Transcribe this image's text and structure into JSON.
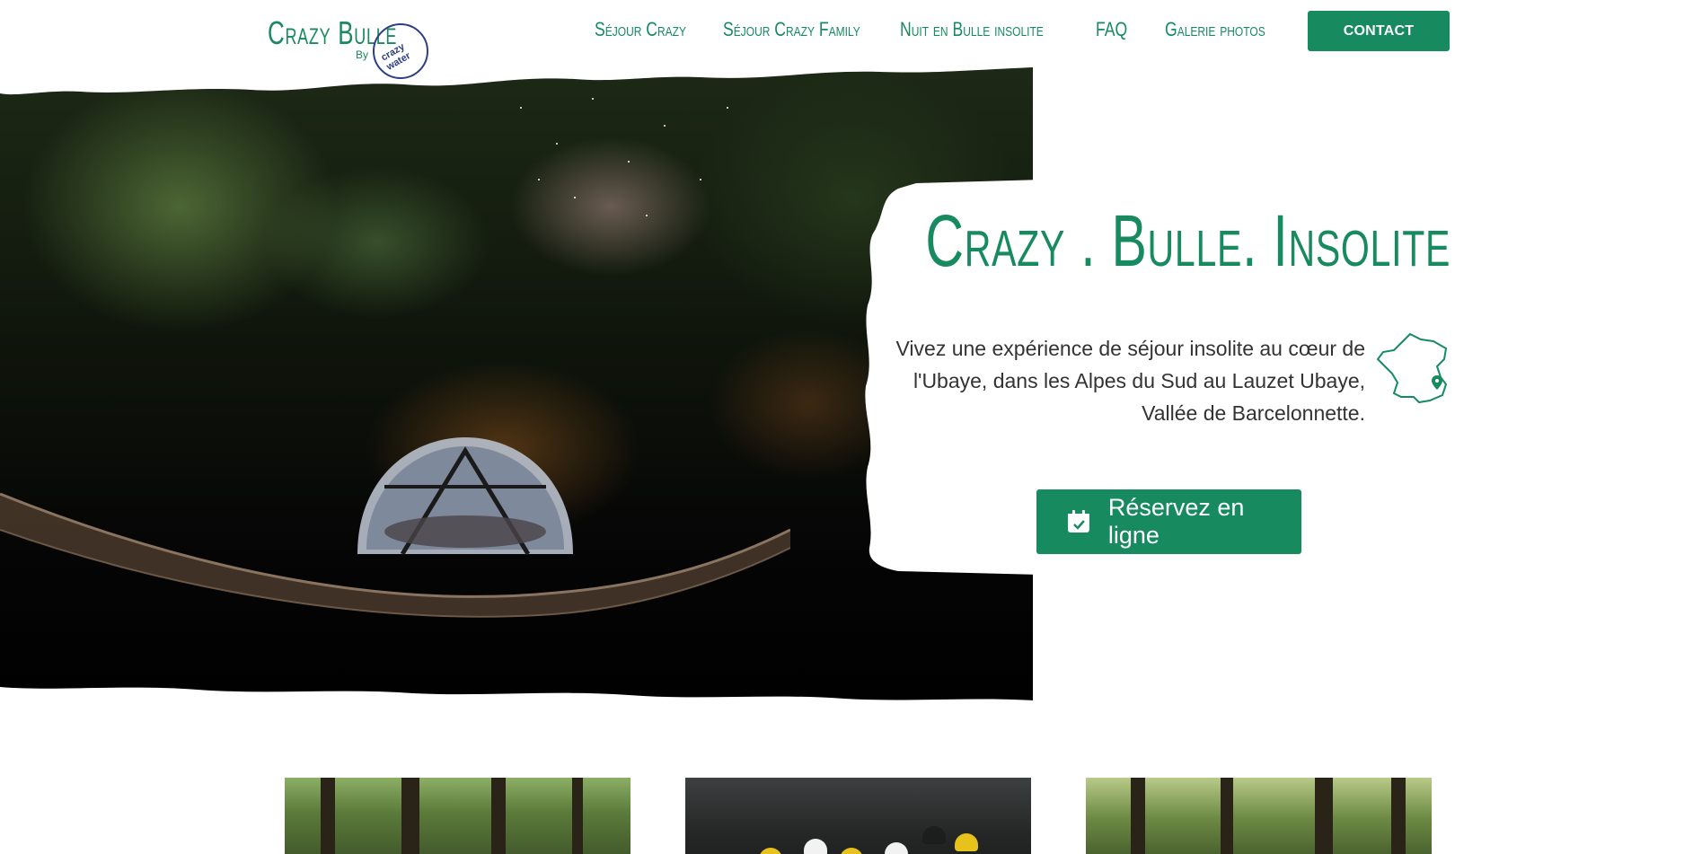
{
  "header": {
    "logo_text": "Crazy Bulle",
    "logo_by": "By",
    "logo_badge_text": "crazy water",
    "nav": [
      {
        "label": "Séjour Crazy"
      },
      {
        "label": "Séjour Crazy Family"
      },
      {
        "label": "Nuit en Bulle insolite"
      },
      {
        "label": "FAQ"
      },
      {
        "label": "Galerie photos"
      }
    ],
    "contact_label": "CONTACT"
  },
  "hero": {
    "title": "Crazy . Bulle. Insolite",
    "description": "Vivez une expérience de séjour insolite au cœur de l'Ubaye, dans les Alpes du Sud au Lauzet Ubaye, Vallée de Barcelonnette.",
    "reserve_label": "Réservez en ligne",
    "map_icon": "france-map-icon",
    "calendar_icon": "calendar-check-icon"
  },
  "colors": {
    "brand_green": "#178a5f",
    "navy": "#2d3f84",
    "text": "#333333"
  }
}
